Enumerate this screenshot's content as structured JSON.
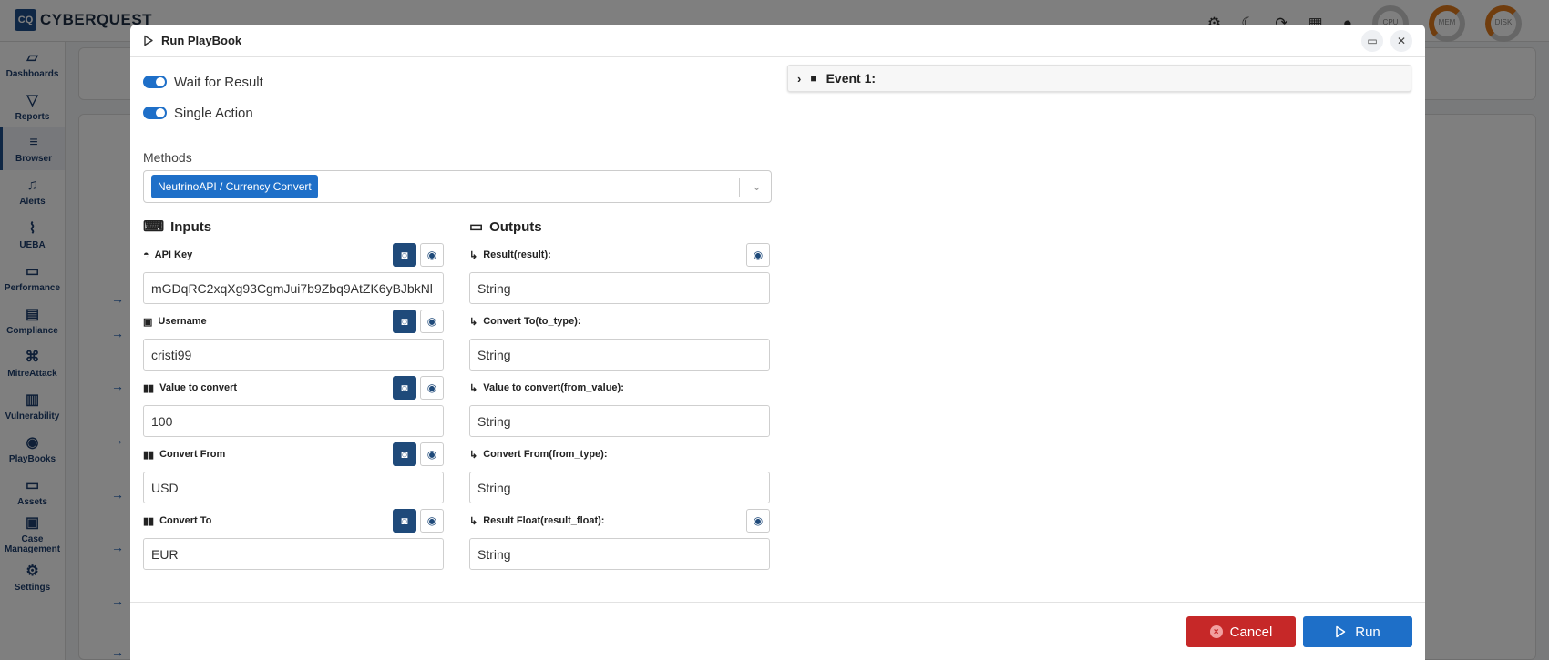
{
  "app": {
    "logo_mark": "CQ",
    "logo_text": "CYBERQUEST",
    "gauges": [
      {
        "label": "CPU"
      },
      {
        "label": "MEM"
      },
      {
        "label": "DISK"
      }
    ],
    "sidebar": [
      {
        "label": "Dashboards",
        "icon": "dashboard-icon"
      },
      {
        "label": "Reports",
        "icon": "filter-icon"
      },
      {
        "label": "Browser",
        "icon": "list-icon"
      },
      {
        "label": "Alerts",
        "icon": "bell-icon"
      },
      {
        "label": "UEBA",
        "icon": "chart-icon"
      },
      {
        "label": "Performance",
        "icon": "keyboard-icon"
      },
      {
        "label": "Compliance",
        "icon": "compliance-icon"
      },
      {
        "label": "MitreAttack",
        "icon": "command-icon"
      },
      {
        "label": "Vulnerability",
        "icon": "toggle-icon"
      },
      {
        "label": "PlayBooks",
        "icon": "playbook-icon"
      },
      {
        "label": "Assets",
        "icon": "laptop-icon"
      },
      {
        "label": "Case Management",
        "icon": "briefcase-icon"
      },
      {
        "label": "Settings",
        "icon": "gear-icon"
      }
    ]
  },
  "modal": {
    "title": "Run PlayBook",
    "toggles": [
      {
        "label": "Wait for Result",
        "on": true
      },
      {
        "label": "Single Action",
        "on": true
      }
    ],
    "methods_label": "Methods",
    "method_chip": "NeutrinoAPI / Currency Convert",
    "inputs_title": "Inputs",
    "outputs_title": "Outputs",
    "inputs": [
      {
        "label": "API Key",
        "value": "mGDqRC2xqXg93CgmJui7b9Zbq9AtZK6yBJbkNl"
      },
      {
        "label": "Username",
        "value": "cristi99"
      },
      {
        "label": "Value to convert",
        "value": "100"
      },
      {
        "label": "Convert From",
        "value": "USD"
      },
      {
        "label": "Convert To",
        "value": "EUR"
      }
    ],
    "outputs": [
      {
        "label": "Result(result):",
        "value": "String",
        "has_eye": true
      },
      {
        "label": "Convert To(to_type):",
        "value": "String",
        "has_eye": false
      },
      {
        "label": "Value to convert(from_value):",
        "value": "String",
        "has_eye": false
      },
      {
        "label": "Convert From(from_type):",
        "value": "String",
        "has_eye": false
      },
      {
        "label": "Result Float(result_float):",
        "value": "String",
        "has_eye": true
      }
    ],
    "event_label": "Event 1:",
    "cancel_label": "Cancel",
    "run_label": "Run"
  }
}
